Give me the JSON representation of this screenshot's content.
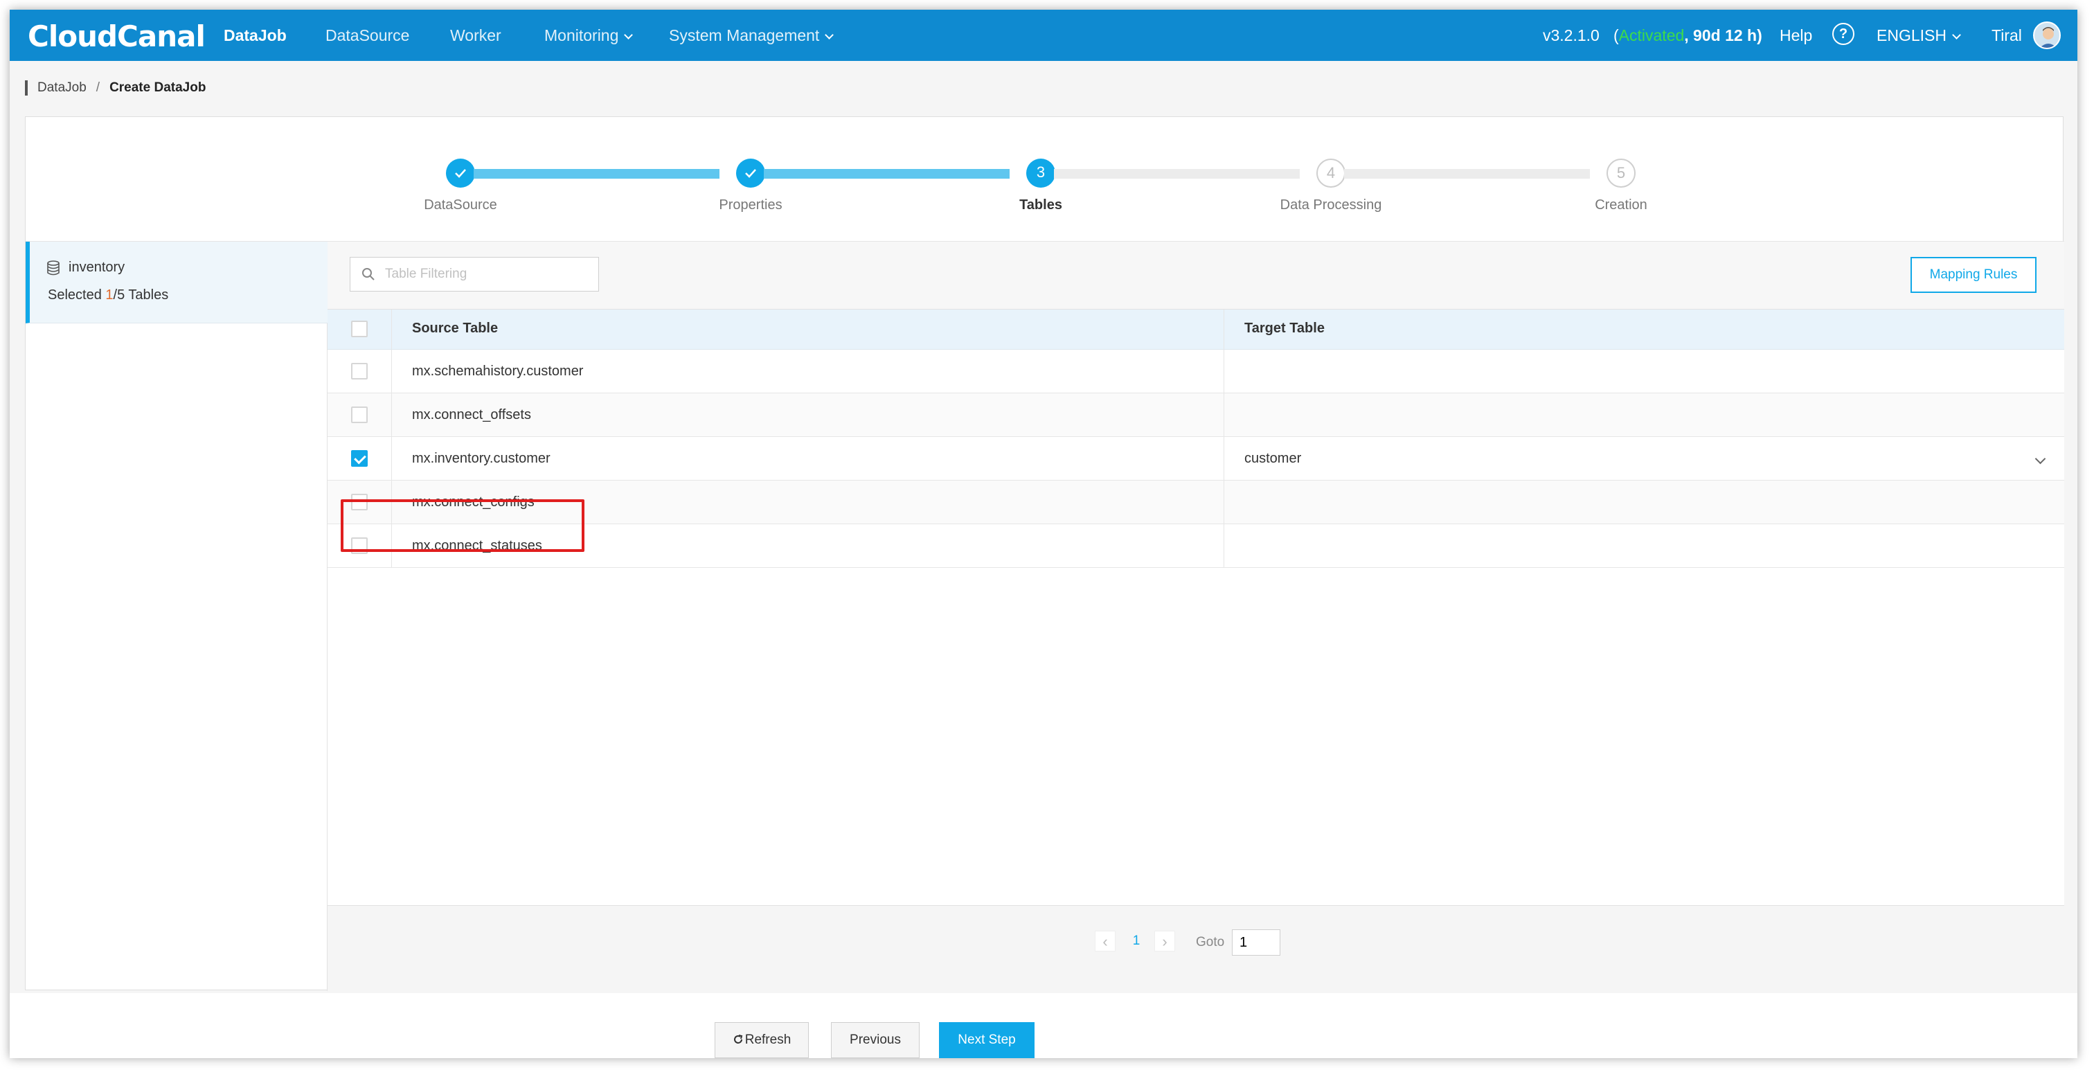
{
  "nav": {
    "logo": "CloudCanal",
    "items": [
      "DataJob",
      "DataSource",
      "Worker",
      "Monitoring",
      "System Management"
    ],
    "version": "v3.2.1.0",
    "license_open": "(",
    "license_status": "Activated",
    "license_remaining": ", 90d 12 h)",
    "help": "Help",
    "help_icon": "?",
    "language": "ENGLISH",
    "user": "Tiral"
  },
  "breadcrumb": {
    "parent": "DataJob",
    "separator": "/",
    "current": "Create DataJob"
  },
  "steps": [
    {
      "label": "DataSource",
      "state": "done",
      "num": "1"
    },
    {
      "label": "Properties",
      "state": "done",
      "num": "2"
    },
    {
      "label": "Tables",
      "state": "current",
      "num": "3"
    },
    {
      "label": "Data Processing",
      "state": "todo",
      "num": "4"
    },
    {
      "label": "Creation",
      "state": "todo",
      "num": "5"
    }
  ],
  "left": {
    "db_name": "inventory",
    "selected_prefix": "Selected ",
    "selected_count": "1",
    "selected_suffix": "/5 Tables"
  },
  "toolbar": {
    "search_placeholder": "Table Filtering",
    "mapping_rules": "Mapping Rules"
  },
  "table": {
    "columns": [
      "Source Table",
      "Target Table"
    ],
    "rows": [
      {
        "source": "mx.schemahistory.customer",
        "target": "",
        "checked": false
      },
      {
        "source": "mx.connect_offsets",
        "target": "",
        "checked": false
      },
      {
        "source": "mx.inventory.customer",
        "target": "customer",
        "checked": true
      },
      {
        "source": "mx.connect_configs",
        "target": "",
        "checked": false
      },
      {
        "source": "mx.connect_statuses",
        "target": "",
        "checked": false
      }
    ]
  },
  "pager": {
    "prev": "‹",
    "page": "1",
    "next": "›",
    "goto_label": "Goto",
    "goto_value": "1"
  },
  "footer": {
    "refresh": "Refresh",
    "previous": "Previous",
    "next_step": "Next Step"
  },
  "colors": {
    "nav_bg": "#0f8ad0",
    "accent": "#10a8e8",
    "activated": "#3ddc4a",
    "highlight": "#e01e1e"
  }
}
